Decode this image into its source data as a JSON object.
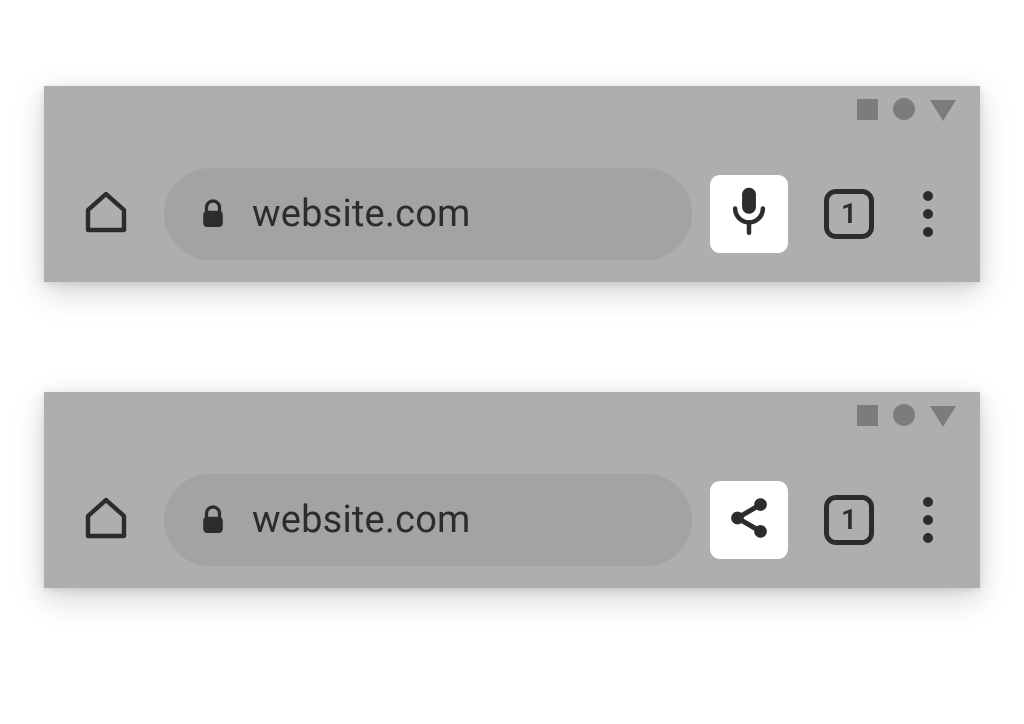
{
  "toolbars": [
    {
      "url": "website.com",
      "tab_count": "1",
      "feature": "mic"
    },
    {
      "url": "website.com",
      "tab_count": "1",
      "feature": "share"
    }
  ]
}
